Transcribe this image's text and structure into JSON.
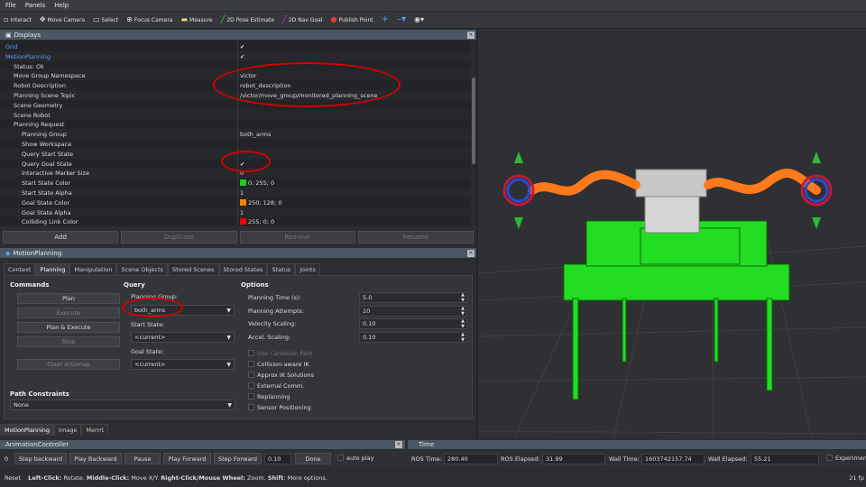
{
  "menu": [
    "File",
    "Panels",
    "Help"
  ],
  "toolbar": [
    {
      "icon": "interact-icon",
      "label": "Interact"
    },
    {
      "icon": "move-camera-icon",
      "label": "Move Camera"
    },
    {
      "icon": "select-icon",
      "label": "Select"
    },
    {
      "icon": "focus-camera-icon",
      "label": "Focus Camera"
    },
    {
      "icon": "measure-icon",
      "label": "Measure"
    },
    {
      "icon": "pose-estimate-icon",
      "label": "2D Pose Estimate"
    },
    {
      "icon": "nav-goal-icon",
      "label": "2D Nav Goal"
    },
    {
      "icon": "publish-point-icon",
      "label": "Publish Point"
    }
  ],
  "displays": {
    "title": "Displays",
    "rows": [
      {
        "name": "Grid",
        "value": "✔",
        "indent": 0,
        "link": true
      },
      {
        "name": "MotionPlanning",
        "value": "✔",
        "indent": 0,
        "link": true
      },
      {
        "name": "Status: Ok",
        "value": "",
        "indent": 1
      },
      {
        "name": "Move Group Namespace",
        "value": "victor",
        "indent": 1
      },
      {
        "name": "Robot Description",
        "value": "robot_description",
        "indent": 1
      },
      {
        "name": "Planning Scene Topic",
        "value": "/victor/move_group/monitored_planning_scene",
        "indent": 1
      },
      {
        "name": "Scene Geometry",
        "value": "",
        "indent": 1
      },
      {
        "name": "Scene Robot",
        "value": "",
        "indent": 1
      },
      {
        "name": "Planning Request",
        "value": "",
        "indent": 1
      },
      {
        "name": "Planning Group",
        "value": "both_arms",
        "indent": 2
      },
      {
        "name": "Show Workspace",
        "value": "",
        "indent": 2
      },
      {
        "name": "Query Start State",
        "value": "",
        "indent": 2
      },
      {
        "name": "Query Goal State",
        "value": "✔",
        "indent": 2
      },
      {
        "name": "Interactive Marker Size",
        "value": "0",
        "indent": 2
      },
      {
        "name": "Start State Color",
        "value": "0; 255; 0",
        "indent": 2,
        "swatch": "#22cc22"
      },
      {
        "name": "Start State Alpha",
        "value": "1",
        "indent": 2
      },
      {
        "name": "Goal State Color",
        "value": "250; 128; 0",
        "indent": 2,
        "swatch": "#fa8000"
      },
      {
        "name": "Goal State Alpha",
        "value": "1",
        "indent": 2
      },
      {
        "name": "Colliding Link Color",
        "value": "255; 0; 0",
        "indent": 2,
        "swatch": "#ff0000"
      }
    ],
    "buttons": [
      "Add",
      "Duplicate",
      "Remove",
      "Rename"
    ]
  },
  "motion_planning": {
    "title": "MotionPlanning",
    "tabs": [
      "Context",
      "Planning",
      "Manipulation",
      "Scene Objects",
      "Stored Scenes",
      "Stored States",
      "Status",
      "Joints"
    ],
    "commands": {
      "heading": "Commands",
      "buttons": [
        "Plan",
        "Execute",
        "Plan & Execute",
        "Stop",
        "Clear octomap"
      ]
    },
    "query": {
      "heading": "Query",
      "planning_group_label": "Planning Group:",
      "planning_group": "both_arms",
      "start_state_label": "Start State:",
      "start_state": "<current>",
      "goal_state_label": "Goal State:",
      "goal_state": "<current>"
    },
    "options": {
      "heading": "Options",
      "planning_time_label": "Planning Time (s):",
      "planning_time": "5.0",
      "planning_attempts_label": "Planning Attempts:",
      "planning_attempts": "10",
      "velocity_scaling_label": "Velocity Scaling:",
      "velocity_scaling": "0.10",
      "accel_scaling_label": "Accel. Scaling:",
      "accel_scaling": "0.10",
      "checks": [
        "Use Cartesian Path",
        "Collision-aware IK",
        "Approx IK Solutions",
        "External Comm.",
        "Replanning",
        "Sensor Positioning"
      ]
    },
    "path_constraints": {
      "heading": "Path Constraints",
      "value": "None"
    }
  },
  "bottom_tabs": [
    "MotionPlanning",
    "Image",
    "Merrrt"
  ],
  "animation": {
    "title": "AnimationController",
    "frame": "0",
    "buttons": [
      "Step backward",
      "Play Backward",
      "Pause",
      "Play Forward",
      "Step Forward"
    ],
    "speed": "0.10",
    "done": "Done",
    "autoplay": "auto play"
  },
  "time": {
    "title": "Time",
    "ros_time_label": "ROS Time:",
    "ros_time": "280.40",
    "ros_elapsed_label": "ROS Elapsed:",
    "ros_elapsed": "31.99",
    "wall_time_label": "Wall Time:",
    "wall_time": "1603742157.74",
    "wall_elapsed_label": "Wall Elapsed:",
    "wall_elapsed": "55.21",
    "experimental": "Experimental"
  },
  "status": {
    "reset": "Reset",
    "hint_bold1": "Left-Click:",
    "hint1": "Rotate.",
    "hint_bold2": "Middle-Click:",
    "hint2": "Move X/Y.",
    "hint_bold3": "Right-Click/Mouse Wheel:",
    "hint3": "Zoom.",
    "hint_bold4": "Shift",
    "hint4": ": More options.",
    "fps": "21 fp"
  }
}
